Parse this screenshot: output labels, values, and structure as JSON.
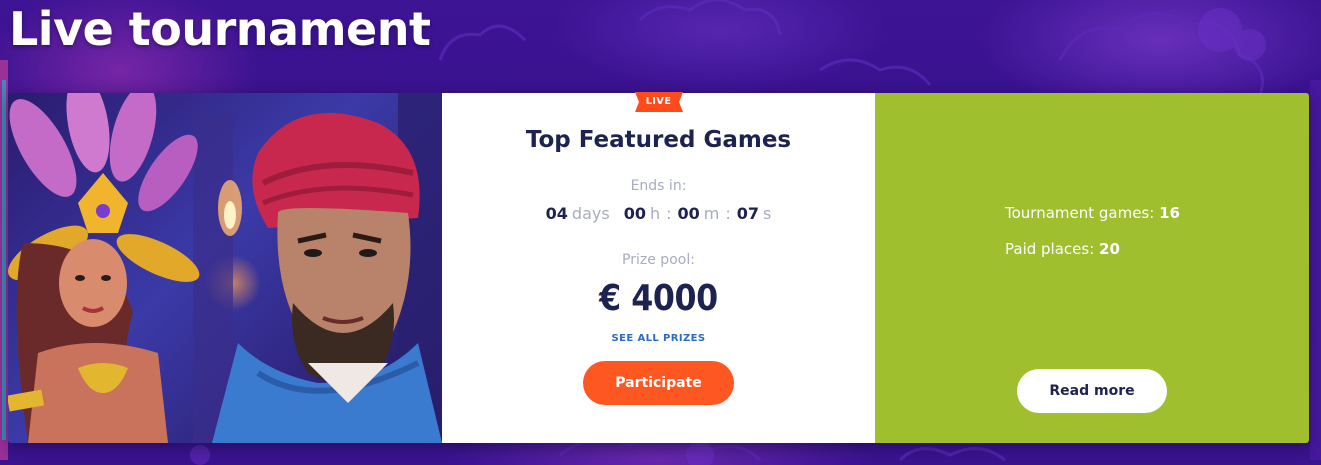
{
  "section": {
    "title": "Live tournament"
  },
  "tournament": {
    "badge": "LIVE",
    "name": "Top Featured Games",
    "ends_label": "Ends in:",
    "countdown": {
      "days": "04",
      "days_unit": "days",
      "hours": "00",
      "hours_unit": "h",
      "minutes": "00",
      "minutes_unit": "m",
      "seconds": "07",
      "seconds_unit": "s",
      "separator": ":"
    },
    "prize_label": "Prize pool:",
    "prize_amount": "€ 4000",
    "see_prizes_label": "SEE ALL PRIZES",
    "participate_label": "Participate"
  },
  "stats": {
    "games_label": "Tournament games:",
    "games_value": "16",
    "places_label": "Paid places:",
    "places_value": "20",
    "read_more_label": "Read more"
  },
  "colors": {
    "background": "#3a1390",
    "accent_orange": "#ff5722",
    "stats_green": "#9fbf2e",
    "title_navy": "#1d2350",
    "link_blue": "#2a6bc8"
  },
  "icons": [
    "live-ribbon-icon"
  ]
}
